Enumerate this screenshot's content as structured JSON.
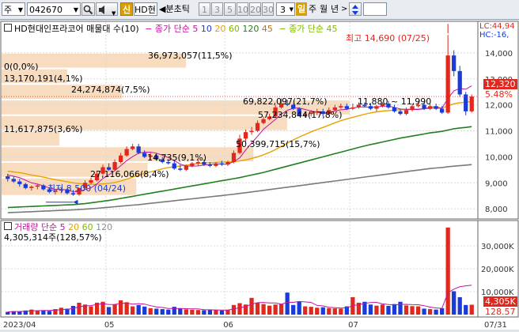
{
  "toolbar": {
    "market": "주",
    "code": "042670",
    "search_icon": "magnifier-icon",
    "sound_icon": "speaker-icon",
    "badge": "신",
    "name": "HD현",
    "period_prefix": "◀분초틱",
    "periods": [
      "1",
      "3",
      "5",
      "10",
      "20",
      "30"
    ],
    "count": "3",
    "interval_day": "일",
    "interval_week": "주",
    "interval_month": "월",
    "interval_year": "년",
    "sort_icon": "up-down-arrow-icon"
  },
  "price_panel": {
    "title": "HD현대인프라코어 매물대 수(10)",
    "ma_label": "종가 단순",
    "ma_periods": [
      {
        "label": "5",
        "color": "#c0149b"
      },
      {
        "label": "10",
        "color": "#1a3bd8"
      },
      {
        "label": "20",
        "color": "#e8a200"
      },
      {
        "label": "60",
        "color": "#80b800"
      },
      {
        "label": "120",
        "color": "#208020"
      },
      {
        "label": "45",
        "color": "#c87000"
      }
    ],
    "ma2_label": "종가 단순 45",
    "lc": "LC:44,94",
    "hc": "HC:-16,",
    "high_label": "최고 14,690 (07/25)",
    "low_label": "최저 8,500 (04/24)",
    "current_price": "12,320",
    "current_change": "5.48%",
    "y_ticks": [
      "14,000",
      "13,000",
      "12,000",
      "11,000",
      "10,000",
      "9,000",
      "8,000"
    ],
    "volume_profile": [
      "0(0,0%)",
      "36,973,057(11,5%)",
      "13,170,191(4,1%)",
      "24,274,874(7,5%)",
      "69,822,097(21,7%)",
      "57,234,844(17,8%)",
      "11,617,875(3,6%)",
      "50,399,715(15,7%)",
      "14,735(9,1%)",
      "27,116,066(8,4%)"
    ],
    "period_range": "11,880 ~ 11,990"
  },
  "volume_panel": {
    "title": "거래량",
    "ma_label": "단순",
    "ma_periods": [
      {
        "label": "5",
        "color": "#c0149b"
      },
      {
        "label": "20",
        "color": "#e8a200"
      },
      {
        "label": "60",
        "color": "#80b800"
      },
      {
        "label": "120",
        "color": "#8a8f99"
      }
    ],
    "last_volume": "4,305,314주(128,57%)",
    "y_ticks": [
      "30,000K",
      "20,000K",
      "10,000K"
    ],
    "current_volume": "4,305K",
    "current_pct": "128.57"
  },
  "x_axis": [
    "2023/04",
    "05",
    "06",
    "07",
    "07/31"
  ],
  "chart_data": {
    "type": "candlestick",
    "x": [
      "2023-04-06",
      "2023-04-07",
      "2023-04-10",
      "2023-04-11",
      "2023-04-12",
      "2023-04-13",
      "2023-04-14",
      "2023-04-17",
      "2023-04-18",
      "2023-04-19",
      "2023-04-20",
      "2023-04-21",
      "2023-04-24",
      "2023-04-25",
      "2023-04-26",
      "2023-04-27",
      "2023-04-28",
      "2023-05-02",
      "2023-05-03",
      "2023-05-04",
      "2023-05-08",
      "2023-05-09",
      "2023-05-10",
      "2023-05-11",
      "2023-05-12",
      "2023-05-15",
      "2023-05-16",
      "2023-05-17",
      "2023-05-18",
      "2023-05-19",
      "2023-05-22",
      "2023-05-23",
      "2023-05-24",
      "2023-05-25",
      "2023-05-26",
      "2023-05-30",
      "2023-05-31",
      "2023-06-01",
      "2023-06-02",
      "2023-06-05",
      "2023-06-07",
      "2023-06-08",
      "2023-06-09",
      "2023-06-12",
      "2023-06-13",
      "2023-06-14",
      "2023-06-15",
      "2023-06-16",
      "2023-06-19",
      "2023-06-20",
      "2023-06-21",
      "2023-06-22",
      "2023-06-23",
      "2023-06-26",
      "2023-06-27",
      "2023-06-28",
      "2023-06-29",
      "2023-06-30",
      "2023-07-03",
      "2023-07-04",
      "2023-07-05",
      "2023-07-06",
      "2023-07-07",
      "2023-07-10",
      "2023-07-11",
      "2023-07-12",
      "2023-07-13",
      "2023-07-14",
      "2023-07-17",
      "2023-07-18",
      "2023-07-19",
      "2023-07-20",
      "2023-07-21",
      "2023-07-24",
      "2023-07-25",
      "2023-07-26",
      "2023-07-27",
      "2023-07-28",
      "2023-07-31"
    ],
    "open": [
      9250,
      9150,
      9050,
      8950,
      8800,
      8850,
      8900,
      8750,
      8650,
      8700,
      8750,
      8600,
      8550,
      8800,
      9000,
      9100,
      9350,
      9600,
      9500,
      9800,
      10050,
      10300,
      10400,
      10150,
      10000,
      10050,
      9900,
      9800,
      9750,
      9550,
      9500,
      9650,
      9750,
      9800,
      9700,
      9650,
      9750,
      9700,
      9800,
      10150,
      10700,
      10950,
      11000,
      11300,
      11450,
      11550,
      11900,
      12050,
      12000,
      11850,
      11600,
      11650,
      11700,
      11750,
      11650,
      11800,
      11900,
      11950,
      11850,
      11900,
      12000,
      11950,
      11850,
      11950,
      12050,
      11900,
      11750,
      11650,
      11800,
      11950,
      12000,
      11850,
      11950,
      11850,
      11700,
      13900,
      13300,
      12400,
      11750
    ],
    "high": [
      9350,
      9250,
      9150,
      9000,
      8900,
      8950,
      8950,
      8800,
      8750,
      8800,
      8800,
      8700,
      8650,
      9100,
      9200,
      9450,
      9700,
      9750,
      9900,
      10150,
      10400,
      10500,
      10500,
      10250,
      10150,
      10150,
      10000,
      9900,
      9850,
      9700,
      9700,
      9800,
      9900,
      9900,
      9800,
      9800,
      9850,
      9850,
      10250,
      10850,
      11050,
      11150,
      11400,
      11550,
      11650,
      12000,
      12250,
      12200,
      12050,
      11900,
      11750,
      11800,
      11850,
      11850,
      11900,
      12000,
      12050,
      12050,
      12050,
      12100,
      12100,
      12050,
      12000,
      12100,
      12150,
      12000,
      11850,
      11900,
      12050,
      12100,
      12100,
      12050,
      12050,
      11950,
      14690,
      14100,
      13500,
      12500,
      12400
    ],
    "low": [
      9050,
      9000,
      8850,
      8750,
      8700,
      8750,
      8700,
      8600,
      8550,
      8600,
      8550,
      8500,
      8500,
      8750,
      8950,
      9050,
      9300,
      9450,
      9450,
      9750,
      10000,
      10250,
      10100,
      9950,
      9900,
      9850,
      9750,
      9700,
      9500,
      9450,
      9450,
      9600,
      9650,
      9650,
      9600,
      9600,
      9650,
      9650,
      9750,
      10100,
      10600,
      10850,
      10950,
      11250,
      11400,
      11500,
      11850,
      11950,
      11800,
      11550,
      11500,
      11550,
      11600,
      11550,
      11600,
      11750,
      11850,
      11800,
      11800,
      11850,
      11900,
      11800,
      11750,
      11900,
      11850,
      11700,
      11600,
      11600,
      11750,
      11900,
      11800,
      11800,
      11800,
      11650,
      11650,
      13100,
      12300,
      11600,
      11700
    ],
    "close": [
      9150,
      9050,
      8950,
      8800,
      8850,
      8900,
      8750,
      8650,
      8700,
      8750,
      8600,
      8550,
      8800,
      9000,
      9100,
      9350,
      9600,
      9500,
      9800,
      10050,
      10300,
      10400,
      10150,
      10000,
      10050,
      9900,
      9800,
      9750,
      9550,
      9500,
      9650,
      9750,
      9800,
      9700,
      9650,
      9750,
      9700,
      9800,
      10150,
      10700,
      10950,
      11000,
      11300,
      11450,
      11550,
      11900,
      12050,
      12000,
      11850,
      11600,
      11650,
      11700,
      11750,
      11650,
      11800,
      11900,
      11950,
      11850,
      11900,
      12000,
      11950,
      11850,
      11950,
      12050,
      11900,
      11750,
      11650,
      11800,
      11950,
      12000,
      11850,
      11950,
      11850,
      11700,
      13900,
      13300,
      12400,
      11750,
      12320
    ],
    "volume": [
      1200,
      1500,
      1400,
      1800,
      2200,
      1700,
      1900,
      1600,
      2400,
      3000,
      2600,
      3800,
      5200,
      4400,
      3600,
      5200,
      5600,
      3300,
      4500,
      6200,
      5400,
      3600,
      4200,
      3500,
      2800,
      2600,
      2400,
      2200,
      3400,
      2600,
      2300,
      2100,
      2000,
      1900,
      2200,
      2000,
      1800,
      2100,
      4200,
      5000,
      4400,
      7300,
      5200,
      4600,
      3900,
      4400,
      4600,
      9600,
      4200,
      5800,
      3600,
      3400,
      3000,
      3200,
      2800,
      2700,
      2600,
      3600,
      7600,
      5200,
      5600,
      4400,
      3900,
      4400,
      3800,
      4600,
      5600,
      4000,
      3700,
      3600,
      2600,
      2400,
      2200,
      2800,
      38000,
      10200,
      7600,
      4200,
      4305
    ],
    "ma5": [
      9300,
      9250,
      9200,
      9100,
      9000,
      8950,
      8880,
      8800,
      8750,
      8740,
      8730,
      8650,
      8660,
      8740,
      8810,
      8960,
      9170,
      9310,
      9470,
      9660,
      9850,
      10010,
      10140,
      10180,
      10180,
      10140,
      10060,
      9970,
      9850,
      9720,
      9650,
      9640,
      9650,
      9680,
      9710,
      9730,
      9720,
      9720,
      9810,
      9960,
      10260,
      10530,
      10790,
      11060,
      11250,
      11440,
      11640,
      11790,
      11870,
      11880,
      11820,
      11760,
      11720,
      11670,
      11710,
      11760,
      11810,
      11830,
      11880,
      11920,
      11920,
      11910,
      11910,
      11950,
      11950,
      11900,
      11840,
      11830,
      11820,
      11820,
      11850,
      11910,
      11920,
      11870,
      12250,
      12540,
      12630,
      12600,
      12730
    ],
    "ma20": [
      9450,
      9420,
      9390,
      9350,
      9300,
      9260,
      9220,
      9170,
      9120,
      9080,
      9040,
      9000,
      8970,
      8950,
      8940,
      8940,
      8960,
      8980,
      9010,
      9070,
      9140,
      9220,
      9290,
      9360,
      9420,
      9480,
      9540,
      9590,
      9620,
      9650,
      9680,
      9710,
      9740,
      9760,
      9780,
      9790,
      9800,
      9800,
      9810,
      9840,
      9880,
      9940,
      10000,
      10080,
      10170,
      10280,
      10400,
      10530,
      10650,
      10760,
      10860,
      10960,
      11050,
      11130,
      11220,
      11310,
      11390,
      11460,
      11520,
      11580,
      11640,
      11690,
      11730,
      11760,
      11780,
      11800,
      11810,
      11820,
      11830,
      11840,
      11850,
      11860,
      11860,
      11870,
      11970,
      12040,
      12080,
      12100,
      12130
    ],
    "ma60": [
      8050,
      8060,
      8070,
      8080,
      8090,
      8100,
      8110,
      8120,
      8130,
      8140,
      8150,
      8160,
      8180,
      8200,
      8230,
      8260,
      8290,
      8320,
      8360,
      8400,
      8440,
      8480,
      8520,
      8560,
      8600,
      8640,
      8680,
      8720,
      8760,
      8800,
      8840,
      8880,
      8920,
      8960,
      9000,
      9040,
      9080,
      9120,
      9160,
      9200,
      9250,
      9300,
      9350,
      9400,
      9460,
      9520,
      9580,
      9640,
      9700,
      9760,
      9820,
      9880,
      9940,
      10000,
      10060,
      10120,
      10180,
      10240,
      10300,
      10360,
      10420,
      10470,
      10520,
      10570,
      10620,
      10670,
      10720,
      10760,
      10800,
      10840,
      10880,
      10920,
      10950,
      10980,
      11030,
      11080,
      11110,
      11130,
      11160
    ],
    "ma120": [
      7850,
      7860,
      7870,
      7880,
      7890,
      7900,
      7910,
      7920,
      7930,
      7940,
      7950,
      7960,
      7970,
      7985,
      8000,
      8020,
      8040,
      8060,
      8080,
      8100,
      8120,
      8140,
      8160,
      8185,
      8210,
      8235,
      8260,
      8285,
      8310,
      8335,
      8360,
      8385,
      8410,
      8435,
      8460,
      8485,
      8510,
      8535,
      8560,
      8590,
      8620,
      8650,
      8680,
      8710,
      8740,
      8770,
      8800,
      8830,
      8860,
      8890,
      8920,
      8950,
      8980,
      9010,
      9040,
      9070,
      9100,
      9130,
      9160,
      9190,
      9220,
      9250,
      9280,
      9310,
      9340,
      9370,
      9400,
      9430,
      9460,
      9490,
      9520,
      9550,
      9570,
      9590,
      9620,
      9640,
      9660,
      9680,
      9700
    ],
    "ylim_price": [
      7700,
      15000
    ],
    "ylim_volume": [
      0,
      40000
    ],
    "y_ticks_price": [
      8000,
      9000,
      10000,
      11000,
      12000,
      13000,
      14000
    ],
    "y_ticks_volume": [
      10000,
      20000,
      30000
    ],
    "volume_profile_rows": [
      {
        "price_from": 14000,
        "price_to": 14690,
        "pct": 0.0
      },
      {
        "price_from": 13400,
        "price_to": 14000,
        "pct": 11.5
      },
      {
        "price_from": 12800,
        "price_to": 13400,
        "pct": 4.1
      },
      {
        "price_from": 12200,
        "price_to": 12800,
        "pct": 7.5
      },
      {
        "price_from": 11600,
        "price_to": 12200,
        "pct": 21.7
      },
      {
        "price_from": 11000,
        "price_to": 11600,
        "pct": 17.8
      },
      {
        "price_from": 10400,
        "price_to": 11000,
        "pct": 3.6
      },
      {
        "price_from": 9800,
        "price_to": 10400,
        "pct": 15.7
      },
      {
        "price_from": 9200,
        "price_to": 9800,
        "pct": 9.1
      },
      {
        "price_from": 8500,
        "price_to": 9200,
        "pct": 8.4
      }
    ],
    "colors": {
      "up": "#e0281e",
      "down": "#1a3bd8",
      "volume_up": "#e0281e",
      "volume_down": "#1a3bd8",
      "profile": "#f8dcc0"
    }
  }
}
